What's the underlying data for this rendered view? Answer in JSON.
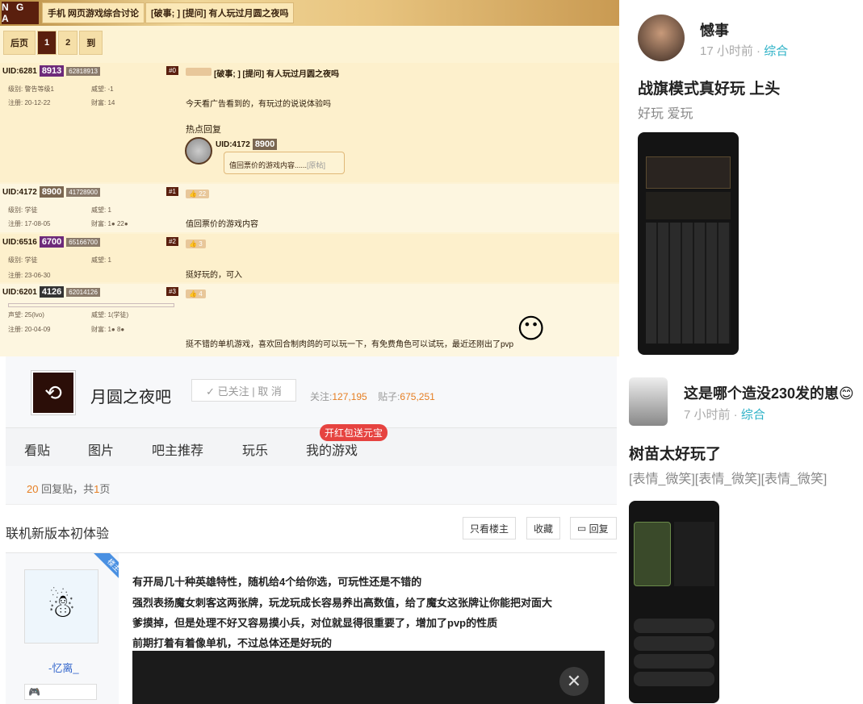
{
  "nga": {
    "logo": "N G A",
    "crumbs": [
      "手机 网页游戏综合讨论",
      "[破事; ] [提问] 有人玩过月圆之夜吗"
    ],
    "pager": [
      "后页",
      "1",
      "2",
      "到"
    ],
    "op": {
      "uid_pre": "UID:6281",
      "uid_hl": "8913",
      "uid_full": "62818913",
      "floor": "#0",
      "level": "级别: 警告等级1",
      "prestige": "威望: -1",
      "reg": "注册: 20-12-22",
      "wealth": "财富: 14",
      "title": "[破事; ] [提问] 有人玩过月圆之夜吗",
      "text": "今天看广告看到的，有玩过的说说体验吗",
      "hot_label": "热点回复",
      "hot_uid_pre": "UID:4172",
      "hot_uid_hl": "8900",
      "hot_text": "值回票价的游戏内容......",
      "hot_more": "[原帖]"
    },
    "r1": {
      "uid_pre": "UID:4172",
      "uid_hl": "8900",
      "uid_full": "41728900",
      "floor": "#1",
      "level": "级别: 学徒",
      "prestige": "威望: 1",
      "reg": "注册: 17-08-05",
      "wealth": "财富: 1",
      "wealth2": "22",
      "likes": "22",
      "text": "值回票价的游戏内容"
    },
    "r2": {
      "uid_pre": "UID:6516",
      "uid_hl": "6700",
      "uid_full": "65166700",
      "floor": "#2",
      "level": "级别: 学徒",
      "prestige": "威望: 1",
      "reg": "注册: 23-06-30",
      "likes": "3",
      "text": "挺好玩的，可入"
    },
    "r3": {
      "uid_pre": "UID:6201",
      "uid_hl": "4126",
      "uid_full": "62014126",
      "floor": "#3",
      "level": "声望: 25(lvo)",
      "prestige": "威望: 1(学徒)",
      "reg": "注册: 20-04-09",
      "wealth": "财富: 1",
      "wealth2": "8",
      "likes": "4",
      "text": "挺不错的单机游戏，喜欢回合制肉鸽的可以玩一下，有免费角色可以试玩，最近还刚出了pvp"
    }
  },
  "tieba": {
    "bar_name": "月圆之夜吧",
    "follow": "✓ 已关注 | 取 消",
    "follow_label": "关注:",
    "follow_n": "127,195",
    "posts_label": "贴子:",
    "posts_n": "675,251",
    "nav": [
      "看贴",
      "图片",
      "吧主推荐",
      "玩乐",
      "我的游戏"
    ],
    "badge": "开红包送元宝",
    "count_n": "20",
    "count_mid": " 回复贴，共",
    "count_p": "1",
    "count_end": "页",
    "post_title": "联机新版本初体验",
    "btns": [
      "只看楼主",
      "收藏",
      "回复"
    ],
    "lz": "楼主",
    "user": "-忆离_",
    "lines": [
      "有开局几十种英雄特性，随机给4个给你选，可玩性还是不错的",
      "强烈表扬魔女刺客这两张牌，玩龙玩成长容易养出高数值，给了魔女这张牌让你能把对面大",
      "爹摸掉，但是处理不好又容易摸小兵，对位就显得很重要了，增加了pvp的性质",
      "前期打着有着像单机，不过总体还是好玩的"
    ]
  },
  "feed": [
    {
      "name": "憾事",
      "time": "17 小时前 · ",
      "tag": "综合",
      "title": "战旗模式真好玩 上头",
      "sub": "好玩 爱玩"
    },
    {
      "name": "这是哪个造没230发的崽",
      "time": "7 小时前 · ",
      "tag": "综合",
      "title": "树苗太好玩了",
      "sub": "[表情_微笑][表情_微笑][表情_微笑]"
    }
  ]
}
